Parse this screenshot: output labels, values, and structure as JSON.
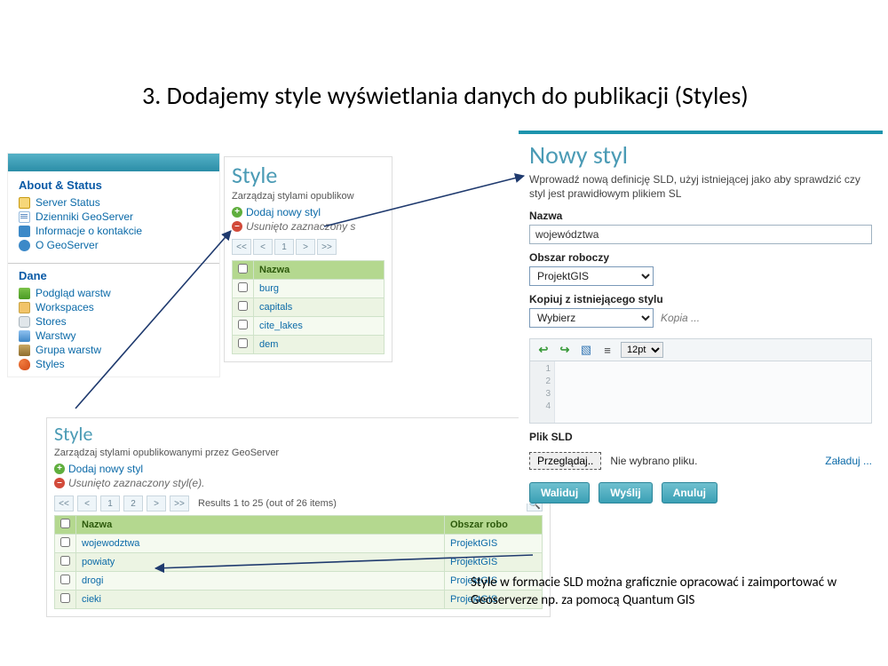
{
  "slide": {
    "title": "3. Dodajemy style wyświetlania danych do publikacji (Styles)"
  },
  "sidebar": {
    "about_heading": "About & Status",
    "data_heading": "Dane",
    "about_items": [
      {
        "label": "Server Status"
      },
      {
        "label": "Dzienniki GeoServer"
      },
      {
        "label": "Informacje o kontakcie"
      },
      {
        "label": "O GeoServer"
      }
    ],
    "data_items": [
      {
        "label": "Podgląd warstw"
      },
      {
        "label": "Workspaces"
      },
      {
        "label": "Stores"
      },
      {
        "label": "Warstwy"
      },
      {
        "label": "Grupa warstw"
      },
      {
        "label": "Styles"
      }
    ]
  },
  "styles_narrow": {
    "heading": "Style",
    "subdesc": "Zarządzaj stylami opublikow",
    "add_label": "Dodaj nowy styl",
    "remove_label": "Usunięto zaznaczony s",
    "pager_first": "<<",
    "pager_prev": "<",
    "pager_page": "1",
    "pager_next": ">",
    "pager_last": ">>",
    "col_name": "Nazwa",
    "rows": [
      {
        "name": "burg"
      },
      {
        "name": "capitals"
      },
      {
        "name": "cite_lakes"
      },
      {
        "name": "dem"
      }
    ]
  },
  "styles_wide": {
    "heading": "Style",
    "subdesc": "Zarządzaj stylami opublikowanymi przez GeoServer",
    "add_label": "Dodaj nowy styl",
    "remove_label": "Usunięto zaznaczony styl(e).",
    "pager_first": "<<",
    "pager_prev": "<",
    "pager_page": "1",
    "pager_page2": "2",
    "pager_next": ">",
    "pager_last": ">>",
    "results_text": "Results 1 to 25 (out of 26 items)",
    "col_name": "Nazwa",
    "col_ws": "Obszar robo",
    "rows": [
      {
        "name": "wojewodztwa",
        "ws": "ProjektGIS"
      },
      {
        "name": "powiaty",
        "ws": "ProjektGIS"
      },
      {
        "name": "drogi",
        "ws": "ProjektGIS"
      },
      {
        "name": "cieki",
        "ws": "ProjektGIS"
      }
    ]
  },
  "new_style": {
    "heading": "Nowy styl",
    "desc": "Wprowadź nową definicję SLD, użyj istniejącej jako aby sprawdzić czy styl jest prawidłowym plikiem SL",
    "name_label": "Nazwa",
    "name_value": "województwa",
    "workspace_label": "Obszar roboczy",
    "workspace_value": "ProjektGIS",
    "copy_label": "Kopiuj z istniejącego stylu",
    "copy_value": "Wybierz",
    "copy_hint": "Kopia ...",
    "font_size": "12pt",
    "gutter_lines": [
      "1",
      "2",
      "3",
      "4"
    ],
    "sld_label": "Plik SLD",
    "browse_btn": "Przeglądaj..",
    "no_file": "Nie wybrano pliku.",
    "load_link": "Załaduj ...",
    "btn_validate": "Waliduj",
    "btn_submit": "Wyślij",
    "btn_cancel": "Anuluj"
  },
  "annotation": {
    "text": "Style w formacie SLD można graficznie opracować i zaimportować w Geoserverze np. za pomocą Quantum GIS"
  }
}
